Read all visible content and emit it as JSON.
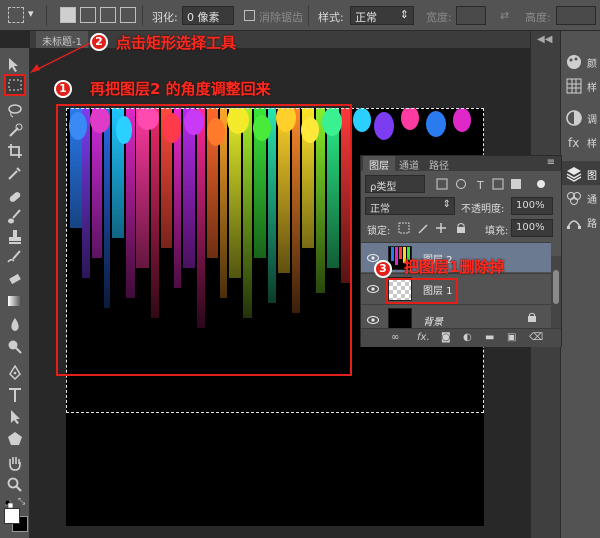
{
  "options_bar": {
    "feather_label": "羽化:",
    "feather_value": "0 像素",
    "antialias_label": "消除锯齿",
    "style_label": "样式:",
    "style_value": "正常",
    "width_label": "宽度:",
    "height_label": "高度:"
  },
  "document": {
    "tab_title": "未标题-1"
  },
  "annotations": {
    "step1_number": "1",
    "step1_text": "再把图层2 的角度调整回来",
    "step2_number": "2",
    "step2_text": "点击矩形选择工具",
    "step3_number": "3",
    "step3_text": "把图层1删除掉",
    "highlight_color": "#e1201a"
  },
  "layers_panel": {
    "tabs": [
      "图层",
      "通道",
      "路径"
    ],
    "filter_kind": "ρ类型",
    "blend_mode": "正常",
    "opacity_label": "不透明度:",
    "opacity_value": "100%",
    "lock_label": "锁定:",
    "fill_label": "填充:",
    "fill_value": "100%",
    "layers": [
      {
        "name": "图层 2"
      },
      {
        "name": "图层 1"
      },
      {
        "name": "背景"
      }
    ],
    "bottom_icons": [
      "link-icon",
      "fx-icon",
      "mask-icon",
      "adjustment-icon",
      "folder-icon",
      "new-layer-icon",
      "trash-icon"
    ]
  },
  "toolbar": {
    "tools": [
      "move-tool",
      "rect-marquee-tool",
      "lasso-tool",
      "quick-select-tool",
      "crop-tool",
      "eyedropper-tool",
      "healing-tool",
      "brush-tool",
      "stamp-tool",
      "history-brush-tool",
      "eraser-tool",
      "gradient-tool",
      "blur-tool",
      "dodge-tool",
      "pen-tool",
      "type-tool",
      "path-select-tool",
      "shape-tool",
      "hand-tool",
      "zoom-tool"
    ]
  },
  "dock": {
    "panel_labels": [
      "颜",
      "样",
      "调",
      "样",
      "图",
      "通",
      "路"
    ]
  }
}
